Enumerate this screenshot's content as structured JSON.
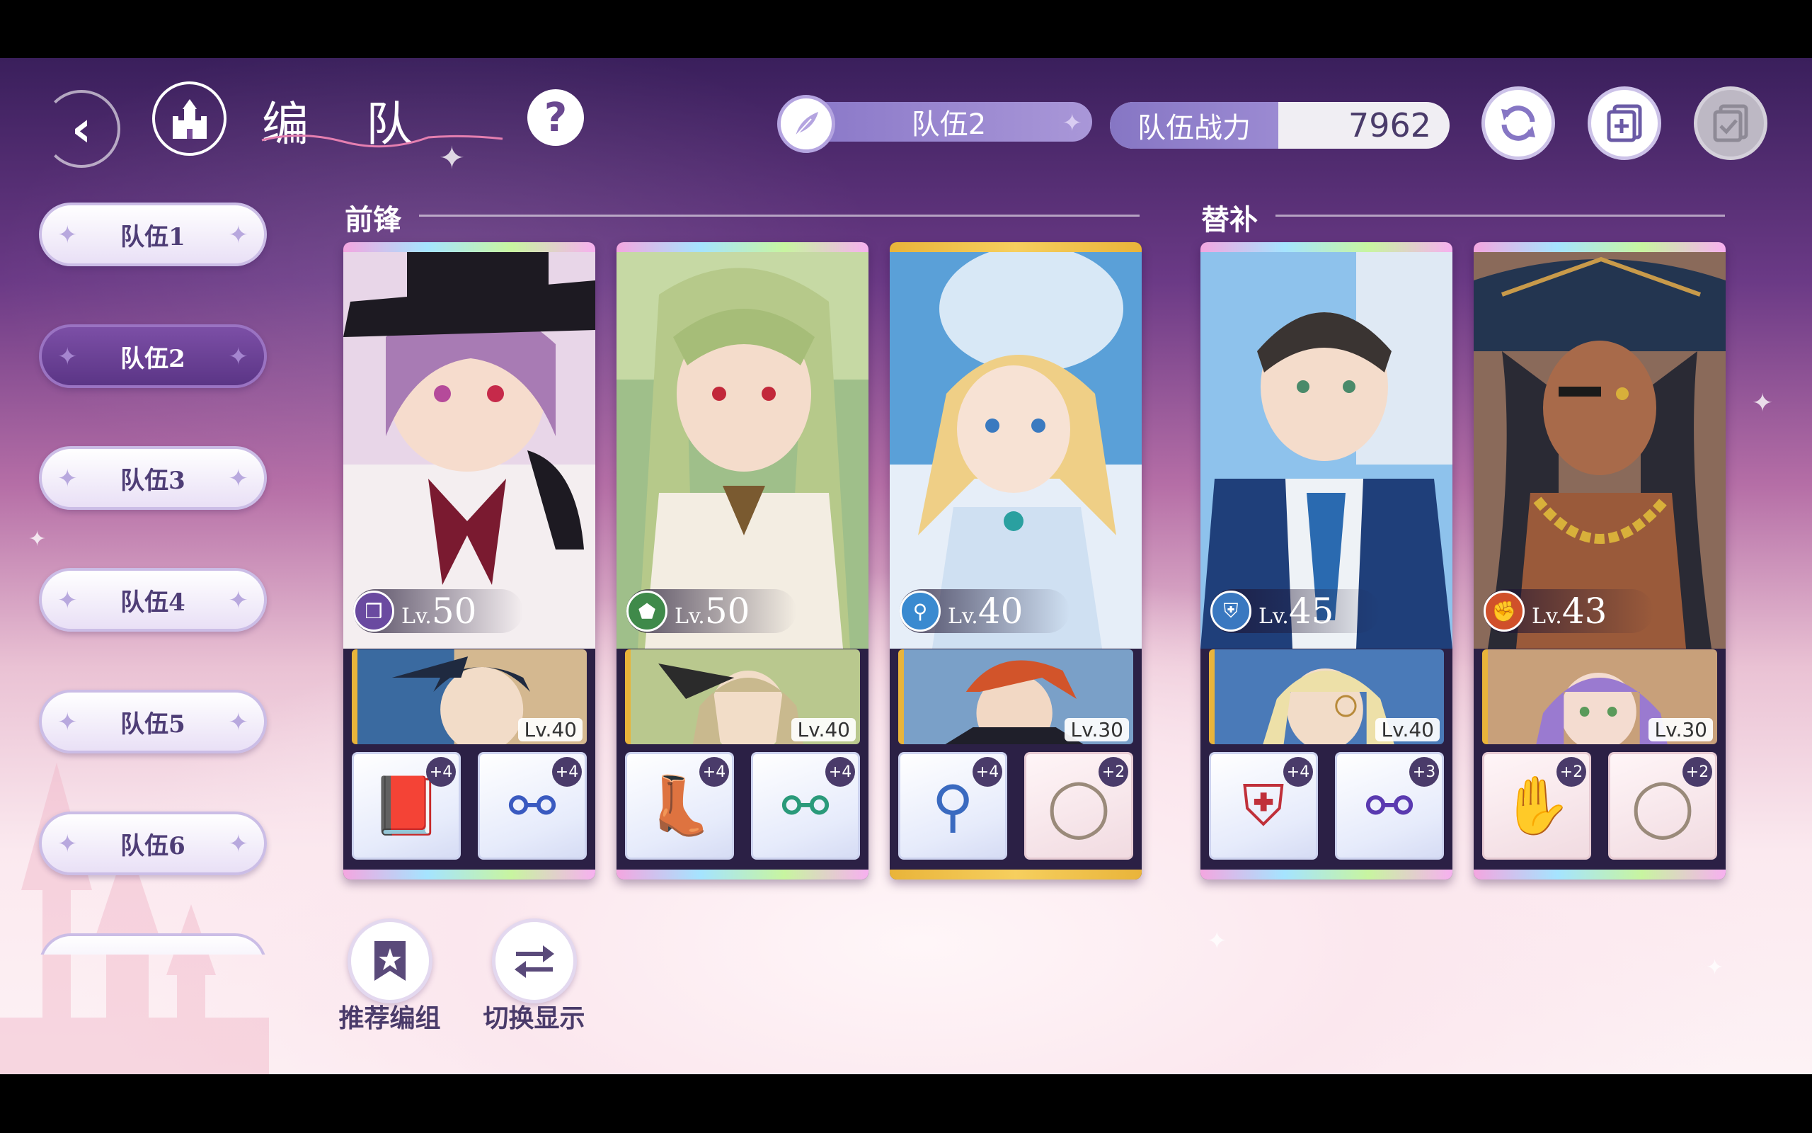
{
  "header": {
    "title": "编 队",
    "current_team": "队伍2",
    "power_label": "队伍战力",
    "power_value": "7962",
    "help_label": "?"
  },
  "team_list": [
    {
      "label": "队伍1",
      "active": false
    },
    {
      "label": "队伍2",
      "active": true
    },
    {
      "label": "队伍3",
      "active": false
    },
    {
      "label": "队伍4",
      "active": false
    },
    {
      "label": "队伍5",
      "active": false
    },
    {
      "label": "队伍6",
      "active": false
    }
  ],
  "sections": {
    "front": "前锋",
    "reserve": "替补"
  },
  "cards": [
    {
      "lv_prefix": "Lv.",
      "level": "50",
      "class_icon": "book-icon",
      "support_lv": "Lv.40",
      "equip": [
        {
          "icon": "spellbook-icon",
          "plus": "+4"
        },
        {
          "icon": "earrings-icon",
          "plus": "+4"
        }
      ]
    },
    {
      "lv_prefix": "Lv.",
      "level": "50",
      "class_icon": "boot-icon",
      "support_lv": "Lv.40",
      "equip": [
        {
          "icon": "boots-icon",
          "plus": "+4"
        },
        {
          "icon": "earrings-icon",
          "plus": "+4"
        }
      ]
    },
    {
      "lv_prefix": "Lv.",
      "level": "40",
      "class_icon": "staff-icon",
      "support_lv": "Lv.30",
      "equip": [
        {
          "icon": "staff-icon",
          "plus": "+4"
        },
        {
          "icon": "ring-icon",
          "plus": "+2"
        }
      ]
    },
    {
      "lv_prefix": "Lv.",
      "level": "45",
      "class_icon": "shield-icon",
      "support_lv": "Lv.40",
      "equip": [
        {
          "icon": "shield-icon",
          "plus": "+4"
        },
        {
          "icon": "earrings-icon",
          "plus": "+3"
        }
      ]
    },
    {
      "lv_prefix": "Lv.",
      "level": "43",
      "class_icon": "fist-icon",
      "support_lv": "Lv.30",
      "equip": [
        {
          "icon": "glove-icon",
          "plus": "+2"
        },
        {
          "icon": "ring-icon",
          "plus": "+2"
        }
      ]
    }
  ],
  "bottom": {
    "recommend_label": "推荐编组",
    "switch_label": "切换显示"
  },
  "colors": {
    "accent": "#8676c4",
    "active_team": "#5b3586",
    "text_dark": "#4a3b6a"
  }
}
